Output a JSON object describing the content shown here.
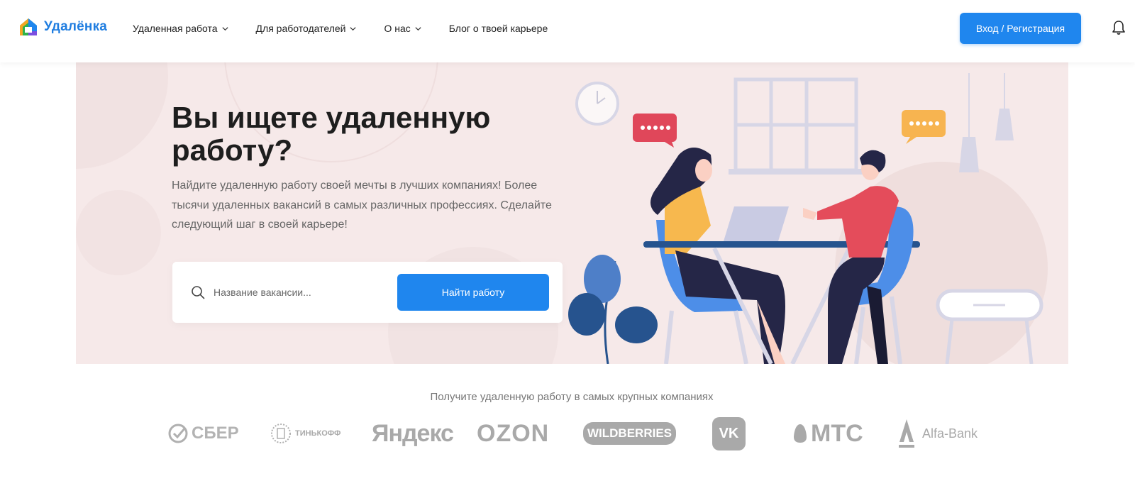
{
  "header": {
    "logo_text": "Удалёнка",
    "nav": [
      {
        "label": "Удаленная работа",
        "has_dropdown": true
      },
      {
        "label": "Для работодателей",
        "has_dropdown": true
      },
      {
        "label": "О нас",
        "has_dropdown": true
      },
      {
        "label": "Блог о твоей карьере",
        "has_dropdown": false
      }
    ],
    "login_label": "Вход / Регистрация",
    "icons": {
      "bell": "bell-icon",
      "chevron": "chevron-down-icon"
    }
  },
  "hero": {
    "title": "Вы ищете удаленную работу?",
    "subtitle": "Найдите удаленную работу своей мечты в лучших компаниях! Более тысячи удаленных вакансий в самых различных профессиях. Сделайте следующий шаг в своей карьере!",
    "search": {
      "placeholder": "Название вакансии...",
      "value": "",
      "button_label": "Найти работу"
    }
  },
  "companies": {
    "title": "Получите удаленную работу в самых крупных компаниях",
    "logos": [
      {
        "name": "СБЕР"
      },
      {
        "name": "ТИНЬКОФФ"
      },
      {
        "name": "Яндекс"
      },
      {
        "name": "OZON"
      },
      {
        "name": "WILDBERRIES"
      },
      {
        "name": "VK"
      },
      {
        "name": "МТС"
      },
      {
        "name": "Alfa-Bank"
      }
    ]
  },
  "colors": {
    "accent": "#1f86ee",
    "hero_bg": "#f6e9e9",
    "logo_gray": "#a9a9a9"
  }
}
